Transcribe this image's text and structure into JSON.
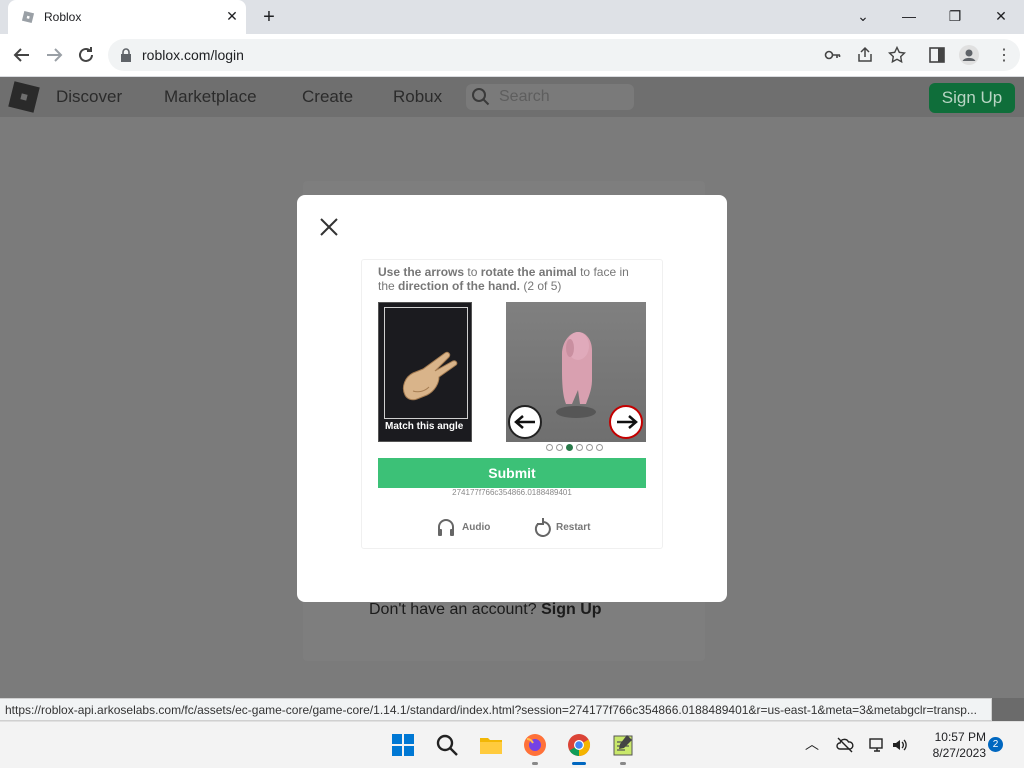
{
  "browser": {
    "tab_title": "Roblox",
    "url": "roblox.com/login",
    "status_url": "https://roblox-api.arkoselabs.com/fc/assets/ec-game-core/game-core/1.14.1/standard/index.html?session=274177f766c354866.0188489401&r=us-east-1&meta=3&metabgclr=transp..."
  },
  "site": {
    "nav": [
      "Discover",
      "Marketplace",
      "Create",
      "Robux"
    ],
    "search_placeholder": "Search",
    "signup_label": "Sign Up",
    "no_account_text": "Don't have an account?",
    "no_account_link": "Sign Up"
  },
  "captcha": {
    "instr_p1": "Use the arrows",
    "instr_p2": " to ",
    "instr_p3": "rotate the animal",
    "instr_p4": " to face in the ",
    "instr_p5": "direction of the hand.",
    "instr_p6": " (2 of 5)",
    "target_label": "Match this angle",
    "submit_label": "Submit",
    "session_id": "274177f766c354866.0188489401",
    "audio_label": "Audio",
    "restart_label": "Restart",
    "progress_total": 6,
    "progress_active_index": 2
  },
  "taskbar": {
    "time": "10:57 PM",
    "date": "8/27/2023",
    "notification_count": "2"
  },
  "colors": {
    "submit": "#3cc177",
    "signup_button": "#0f6e3a",
    "arrow_right_border": "#c40000"
  }
}
